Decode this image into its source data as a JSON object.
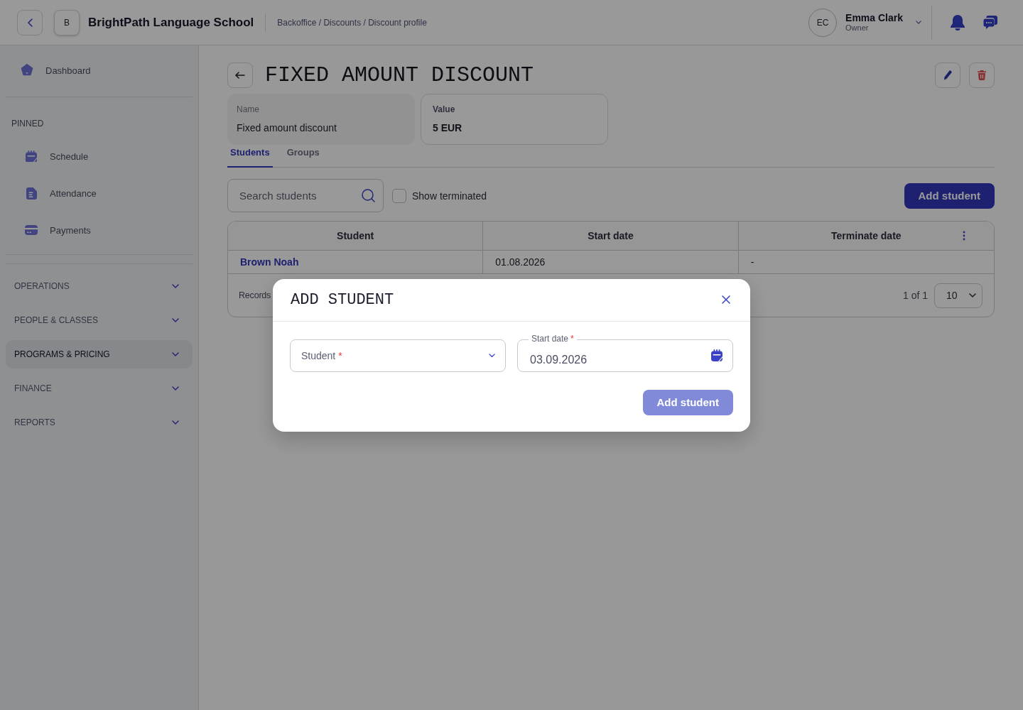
{
  "header": {
    "workspace_initial": "B",
    "school_name": "BrightPath Language School",
    "breadcrumb": "Backoffice / Discounts / Discount profile",
    "user": {
      "initials": "EC",
      "name": "Emma Clark",
      "role": "Owner"
    }
  },
  "sidebar": {
    "dashboard": {
      "label": "Dashboard"
    },
    "pinned_title": "PINNED",
    "pinned": [
      {
        "label": "Schedule"
      },
      {
        "label": "Attendance"
      },
      {
        "label": "Payments"
      }
    ],
    "groups": [
      {
        "label": "OPERATIONS",
        "selected": false,
        "expanded": false
      },
      {
        "label": "PEOPLE & CLASSES",
        "selected": false,
        "expanded": false
      },
      {
        "label": "PROGRAMS & PRICING",
        "selected": true,
        "expanded": false
      },
      {
        "label": "FINANCE",
        "selected": false,
        "expanded": false
      },
      {
        "label": "REPORTS",
        "selected": false,
        "expanded": false
      }
    ]
  },
  "page": {
    "title": "FIXED AMOUNT DISCOUNT",
    "fields": [
      {
        "kind": "filled",
        "label": "Name",
        "value": "Fixed amount discount"
      },
      {
        "kind": "outlined",
        "label": "Value",
        "value": "5 EUR"
      }
    ]
  },
  "tabs": [
    {
      "label": "Students",
      "selected": true
    },
    {
      "label": "Groups",
      "selected": false
    }
  ],
  "toolbar": {
    "search": {
      "placeholder": "Search students"
    },
    "show_terminated": {
      "label": "Show terminated",
      "checked": false
    },
    "add_button": "Add student"
  },
  "table": {
    "columns": [
      "Student",
      "Start date",
      "Terminate date"
    ],
    "rows": [
      {
        "cells": [
          "Brown Noah",
          "01.08.2026",
          "-"
        ]
      }
    ],
    "footer": {
      "records_label": "Records",
      "page_info": "1 of 1",
      "page_size": "10"
    }
  },
  "modal": {
    "title": "ADD STUDENT",
    "fields": [
      {
        "kind": "select",
        "label": "Student",
        "required_mark": "*"
      },
      {
        "kind": "date",
        "label": "Start date",
        "required_mark": "*",
        "value": "03.09.2026"
      }
    ],
    "submit": {
      "label": "Add student",
      "disabled": true
    }
  }
}
